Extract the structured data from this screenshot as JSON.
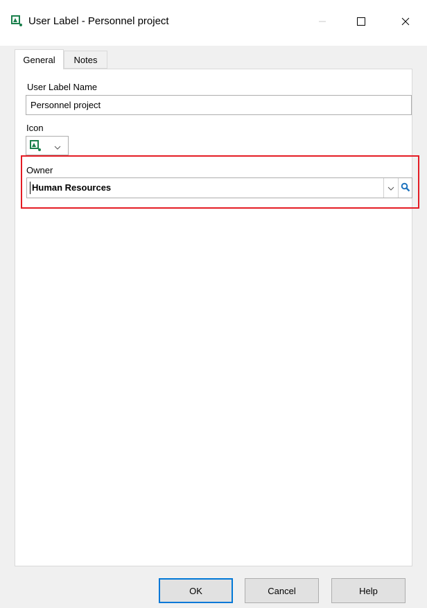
{
  "window": {
    "title": "User Label - Personnel project",
    "app_icon": "user-label-icon"
  },
  "window_controls": {
    "minimize_icon": "minimize-icon",
    "maximize_icon": "maximize-icon",
    "close_icon": "close-icon"
  },
  "tabs": [
    {
      "label": "General",
      "selected": true
    },
    {
      "label": "Notes",
      "selected": false
    }
  ],
  "form": {
    "name_label": "User Label Name",
    "name_value": "Personnel project",
    "icon_label": "Icon",
    "icon_value": "user-label-icon",
    "owner_label": "Owner",
    "owner_value": "Human Resources",
    "owner_highlight_color": "#e41c24"
  },
  "buttons": {
    "ok": "OK",
    "cancel": "Cancel",
    "help": "Help"
  },
  "colors": {
    "icon_green": "#1a7f4b",
    "accent_blue": "#0078d7"
  }
}
